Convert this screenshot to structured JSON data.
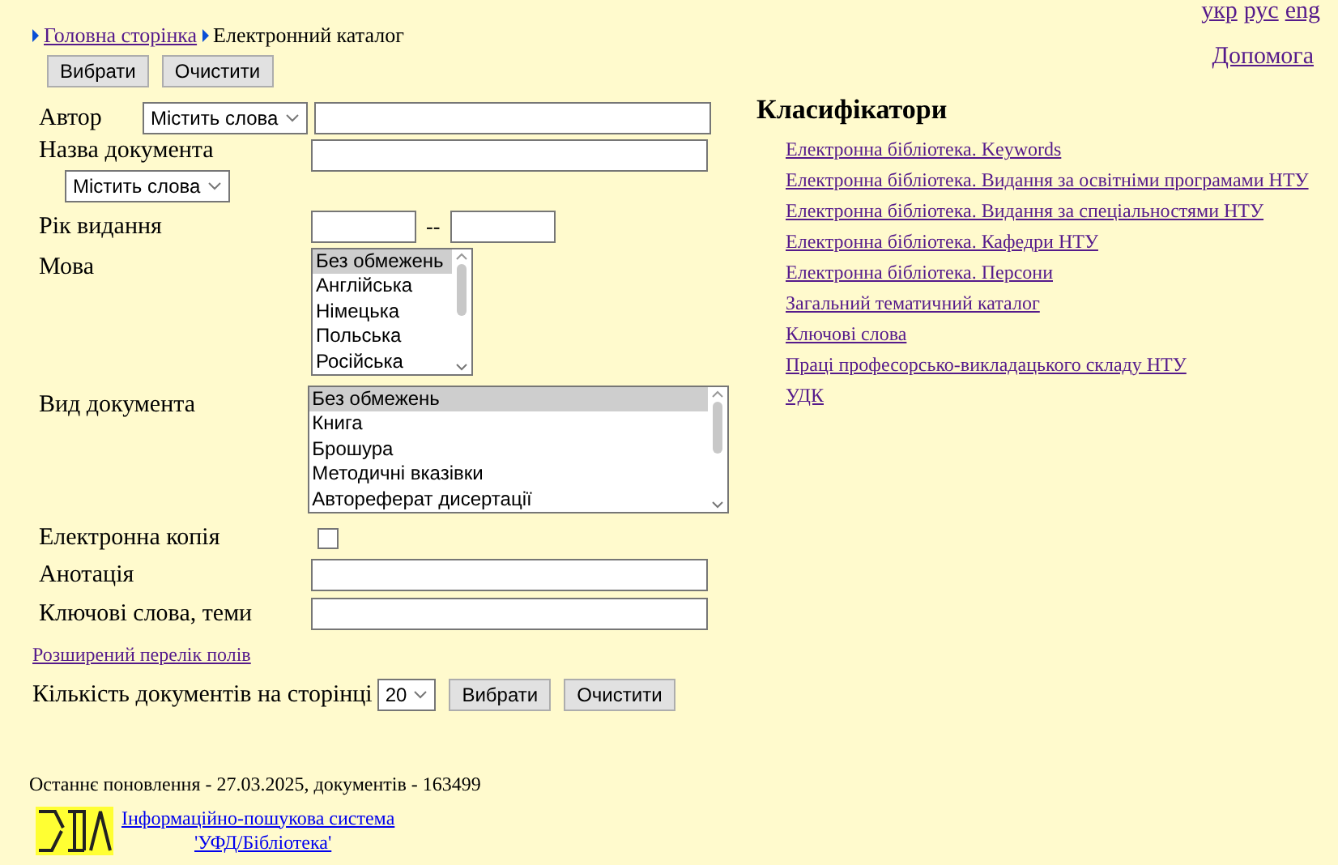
{
  "languages": [
    {
      "label": "укр",
      "visited": true
    },
    {
      "label": "рус",
      "visited": true
    },
    {
      "label": "eng",
      "visited": true
    }
  ],
  "breadcrumb": [
    {
      "label": "Головна сторінка",
      "kind": "link"
    },
    {
      "label": "Електронний каталог",
      "kind": "current"
    }
  ],
  "top_buttons": [
    "Вибрати",
    "Очистити"
  ],
  "help_link": "Допомога",
  "form": [
    {
      "kind": "text_with_mode",
      "label": "Автор",
      "mode": "Містить слова"
    },
    {
      "kind": "text_with_mode_below",
      "label": "Назва документа",
      "mode": "Містить слова"
    },
    {
      "kind": "range",
      "label": "Рік видання",
      "separator": "--"
    },
    {
      "kind": "listbox",
      "label": "Мова",
      "wide": false,
      "options": [
        {
          "label": "Без обмежень",
          "selected": true
        },
        {
          "label": "Англійська",
          "selected": false
        },
        {
          "label": "Німецька",
          "selected": false
        },
        {
          "label": "Польська",
          "selected": false
        },
        {
          "label": "Російська",
          "selected": false
        }
      ]
    },
    {
      "kind": "listbox",
      "label": "Вид документа",
      "wide": true,
      "options": [
        {
          "label": "Без обмежень",
          "selected": true
        },
        {
          "label": "Книга",
          "selected": false
        },
        {
          "label": "Брошура",
          "selected": false
        },
        {
          "label": "Методичні вказівки",
          "selected": false
        },
        {
          "label": "Автореферат дисертації",
          "selected": false
        }
      ]
    },
    {
      "kind": "checkbox",
      "label": "Електронна копія",
      "checked": false
    },
    {
      "kind": "text",
      "label": "Анотація"
    },
    {
      "kind": "text",
      "label": "Ключові слова, теми"
    }
  ],
  "extended_fields_link": "Розширений перелік полів",
  "per_page": {
    "label": "Кількість документів на сторінці",
    "value": "20"
  },
  "bottom_buttons": [
    "Вибрати",
    "Очистити"
  ],
  "classifiers": {
    "title": "Класифікатори",
    "items": [
      {
        "label": "Електронна бібліотека. Keywords"
      },
      {
        "label": "Електронна бібліотека. Видання за освітніми програмами НТУ"
      },
      {
        "label": "Електронна бібліотека. Видання за спеціальностями НТУ"
      },
      {
        "label": "Електронна бібліотека. Кафедри НТУ"
      },
      {
        "label": "Електронна бібліотека. Персони"
      },
      {
        "label": "Загальний тематичний каталог"
      },
      {
        "label": "Ключові слова"
      },
      {
        "label": "Праці професорсько-викладацького складу НТУ"
      },
      {
        "label": "УДК"
      }
    ]
  },
  "footer": {
    "last_update": "Останнє поновлення - 27.03.2025, документів - 163499",
    "system_link_line1": "Інформаційно-пошукова система",
    "system_link_line2": "'УФД/Бібліотека'"
  }
}
